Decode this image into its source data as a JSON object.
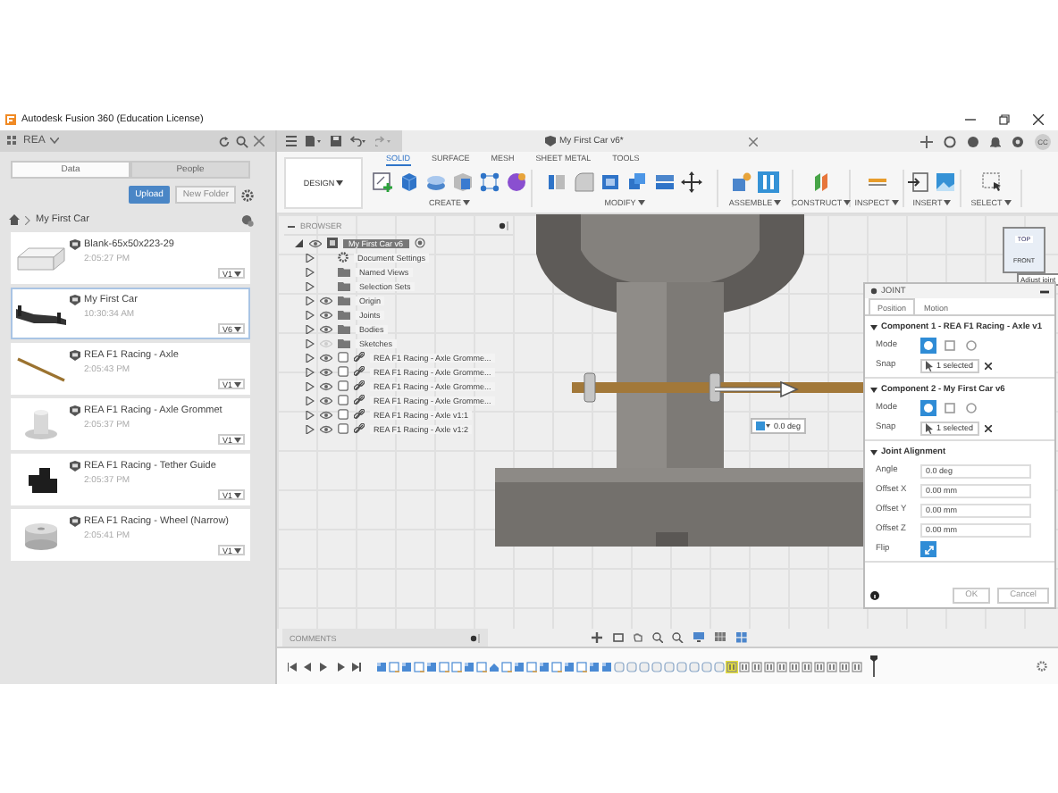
{
  "window": {
    "title": "Autodesk Fusion 360 (Education License)"
  },
  "data_panel": {
    "project": "REA",
    "tabs": [
      {
        "label": "Data",
        "selected": true
      },
      {
        "label": "People",
        "selected": false
      }
    ],
    "upload": "Upload",
    "new_folder": "New Folder",
    "breadcrumb": "My First Car",
    "files": [
      {
        "name": "Blank-65x50x223-29",
        "time": "2:05:27 PM",
        "version": "V1",
        "kind": "block",
        "selected": false
      },
      {
        "name": "My First Car",
        "time": "10:30:34 AM",
        "version": "V6",
        "kind": "car",
        "selected": true
      },
      {
        "name": "REA F1 Racing - Axle",
        "time": "2:05:43 PM",
        "version": "V1",
        "kind": "rod",
        "selected": false
      },
      {
        "name": "REA F1 Racing - Axle Grommet",
        "time": "2:05:37 PM",
        "version": "V1",
        "kind": "grommet",
        "selected": false
      },
      {
        "name": "REA F1 Racing - Tether Guide",
        "time": "2:05:37 PM",
        "version": "V1",
        "kind": "guide",
        "selected": false
      },
      {
        "name": "REA F1 Racing - Wheel (Narrow)",
        "time": "2:05:41 PM",
        "version": "V1",
        "kind": "wheel",
        "selected": false
      }
    ]
  },
  "document_tab": {
    "title": "My First Car v6*"
  },
  "user": {
    "initials": "CC"
  },
  "toolbar": {
    "workspace": "DESIGN",
    "tabs": [
      {
        "label": "SOLID",
        "selected": true
      },
      {
        "label": "SURFACE",
        "selected": false
      },
      {
        "label": "MESH",
        "selected": false
      },
      {
        "label": "SHEET METAL",
        "selected": false
      },
      {
        "label": "TOOLS",
        "selected": false
      }
    ],
    "groups": [
      "CREATE",
      "MODIFY",
      "ASSEMBLE",
      "CONSTRUCT",
      "INSPECT",
      "INSERT",
      "SELECT"
    ]
  },
  "browser": {
    "title": "BROWSER",
    "root": {
      "label": "My First Car v6",
      "expanded": true
    },
    "items": [
      {
        "label": "Document Settings",
        "kind": "settings",
        "expanded": false
      },
      {
        "label": "Named Views",
        "kind": "folder",
        "expanded": false
      },
      {
        "label": "Selection Sets",
        "kind": "folder",
        "expanded": false
      },
      {
        "label": "Origin",
        "kind": "folder",
        "expanded": false,
        "visible": true
      },
      {
        "label": "Joints",
        "kind": "folder",
        "expanded": false,
        "visible": true
      },
      {
        "label": "Bodies",
        "kind": "folder",
        "expanded": false,
        "visible": true
      },
      {
        "label": "Sketches",
        "kind": "folder",
        "expanded": false,
        "visible": false
      },
      {
        "label": "REA F1 Racing - Axle Gromme...",
        "kind": "component",
        "expanded": false,
        "visible": true
      },
      {
        "label": "REA F1 Racing - Axle Gromme...",
        "kind": "component",
        "expanded": false,
        "visible": true
      },
      {
        "label": "REA F1 Racing - Axle Gromme...",
        "kind": "component",
        "expanded": false,
        "visible": true
      },
      {
        "label": "REA F1 Racing - Axle Gromme...",
        "kind": "component",
        "expanded": false,
        "visible": true
      },
      {
        "label": "REA F1 Racing - Axle v1:1",
        "kind": "component",
        "expanded": false,
        "visible": true
      },
      {
        "label": "REA F1 Racing - Axle v1:2",
        "kind": "component",
        "expanded": false,
        "visible": true
      }
    ]
  },
  "canvas": {
    "angle_input": "0.0 deg",
    "viewcube": {
      "top": "TOP",
      "front": "FRONT"
    },
    "tooltip": "Adjust joint"
  },
  "joint": {
    "title": "JOINT",
    "tabs": [
      {
        "label": "Position",
        "selected": true
      },
      {
        "label": "Motion",
        "selected": false
      }
    ],
    "components": [
      {
        "title": "Component 1 - REA F1 Racing - Axle v1",
        "mode_label": "Mode",
        "modes": [
          {
            "selected": true
          },
          {
            "selected": false
          },
          {
            "selected": false
          }
        ],
        "snap_label": "Snap",
        "snap": "1 selected"
      },
      {
        "title": "Component 2 - My First Car v6",
        "mode_label": "Mode",
        "modes": [
          {
            "selected": true
          },
          {
            "selected": false
          },
          {
            "selected": false
          }
        ],
        "snap_label": "Snap",
        "snap": "1 selected"
      }
    ],
    "alignment": {
      "title": "Joint Alignment",
      "fields": [
        {
          "label": "Angle",
          "value": "0.0 deg"
        },
        {
          "label": "Offset X",
          "value": "0.00 mm"
        },
        {
          "label": "Offset Y",
          "value": "0.00 mm"
        },
        {
          "label": "Offset Z",
          "value": "0.00 mm"
        }
      ],
      "flip_label": "Flip",
      "flip": true
    },
    "buttons": [
      "OK",
      "Cancel"
    ]
  },
  "comments": {
    "title": "COMMENTS"
  },
  "timeline": {
    "features": [
      {
        "kind": "body",
        "selected": false
      },
      {
        "kind": "sketch",
        "selected": false
      },
      {
        "kind": "body",
        "selected": false
      },
      {
        "kind": "sketch",
        "selected": false
      },
      {
        "kind": "body",
        "selected": false
      },
      {
        "kind": "sketch",
        "selected": false
      },
      {
        "kind": "sketch",
        "selected": false
      },
      {
        "kind": "body",
        "selected": false
      },
      {
        "kind": "sketch",
        "selected": false
      },
      {
        "kind": "group",
        "selected": false
      },
      {
        "kind": "sketch",
        "selected": false
      },
      {
        "kind": "body",
        "selected": false
      },
      {
        "kind": "sketch",
        "selected": false
      },
      {
        "kind": "body",
        "selected": false
      },
      {
        "kind": "sketch",
        "selected": false
      },
      {
        "kind": "body",
        "selected": false
      },
      {
        "kind": "sketch",
        "selected": false
      },
      {
        "kind": "body",
        "selected": false
      },
      {
        "kind": "body",
        "selected": false
      },
      {
        "kind": "insert",
        "selected": false
      },
      {
        "kind": "insert",
        "selected": false
      },
      {
        "kind": "insert",
        "selected": false
      },
      {
        "kind": "insert",
        "selected": false
      },
      {
        "kind": "insert",
        "selected": false
      },
      {
        "kind": "insert",
        "selected": false
      },
      {
        "kind": "insert",
        "selected": false
      },
      {
        "kind": "insert",
        "selected": false
      },
      {
        "kind": "insert",
        "selected": false
      },
      {
        "kind": "joint",
        "selected": true
      },
      {
        "kind": "joint",
        "selected": false
      },
      {
        "kind": "joint",
        "selected": false
      },
      {
        "kind": "joint",
        "selected": false
      },
      {
        "kind": "joint",
        "selected": false
      },
      {
        "kind": "joint",
        "selected": false
      },
      {
        "kind": "joint",
        "selected": false
      },
      {
        "kind": "joint",
        "selected": false
      },
      {
        "kind": "joint",
        "selected": false
      },
      {
        "kind": "joint",
        "selected": false
      },
      {
        "kind": "joint",
        "selected": false
      }
    ]
  }
}
